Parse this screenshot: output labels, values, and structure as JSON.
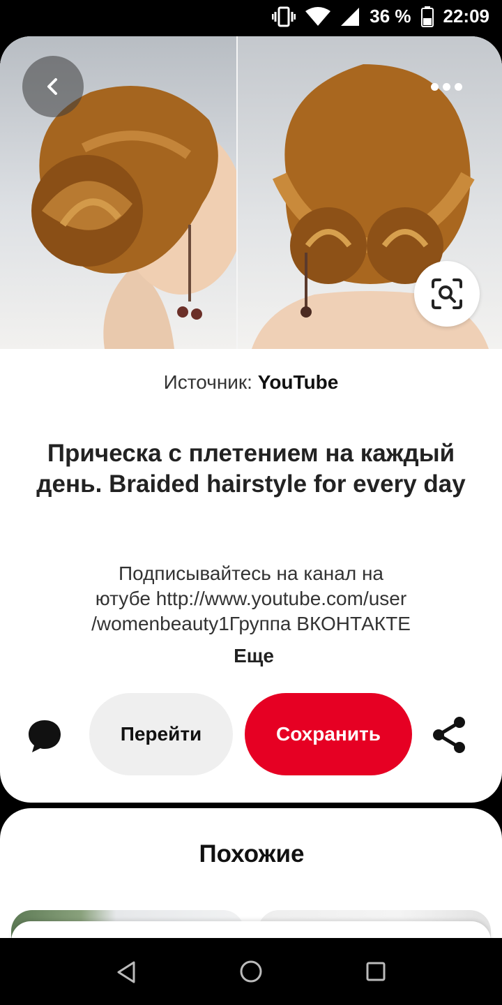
{
  "status_bar": {
    "battery_text": "36 %",
    "time": "22:09",
    "icons": [
      "vibrate-icon",
      "wifi-icon",
      "signal-icon",
      "battery-icon"
    ]
  },
  "pin": {
    "image_alt": "Braided hairstyle back view",
    "source_label": "Источник:",
    "source_name": "YouTube",
    "title": "Прическа с плетением на каждый день. Braided hairstyle for every day",
    "description": "Подписывайтесь на канал на\nютубе http://www.youtube.com/user\n/womenbeauty1Группа ВКОНТАКТЕ",
    "more_label": "Еще",
    "visit_label": "Перейти",
    "save_label": "Сохранить"
  },
  "related": {
    "title": "Похожие"
  },
  "colors": {
    "save_button": "#e60023",
    "visit_button": "#efefef",
    "text_primary": "#222222"
  }
}
